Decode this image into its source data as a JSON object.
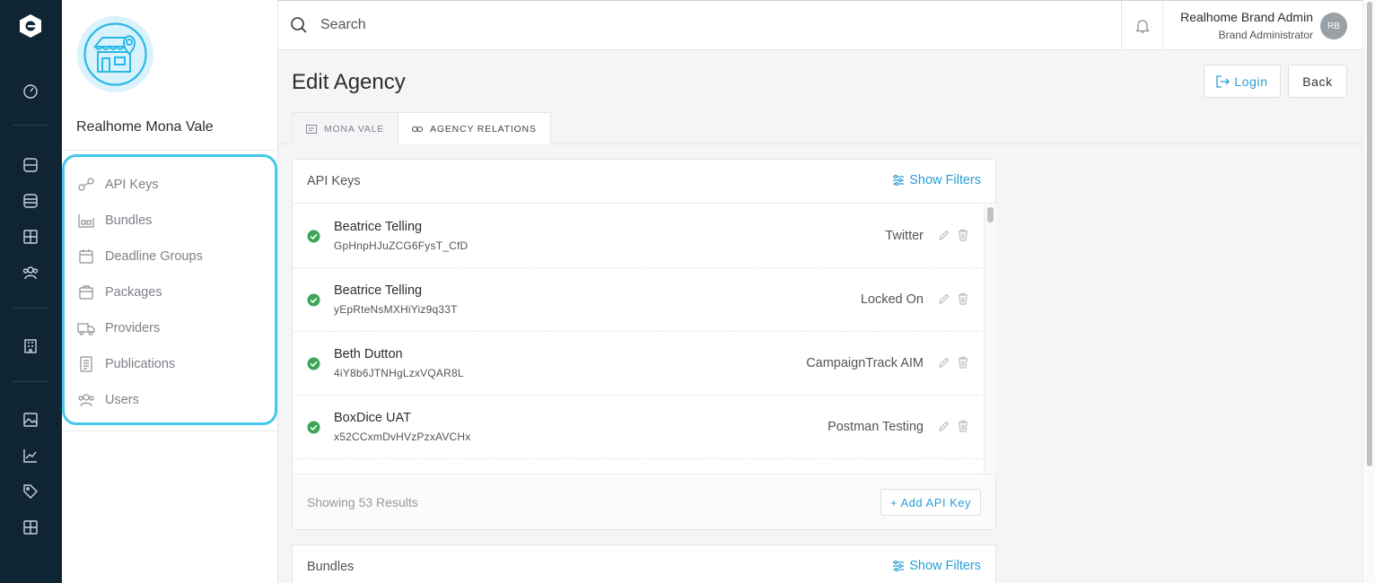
{
  "rail": {
    "icons": [
      "app-logo",
      "gauge-icon",
      "database-icon",
      "server-icon",
      "grid-icon",
      "users-icon",
      "building-icon",
      "image-icon",
      "chart-icon",
      "tag-icon",
      "table-icon"
    ]
  },
  "agency": {
    "name": "Realhome Mona Vale",
    "menu": [
      {
        "label": "API Keys",
        "icon": "api-keys-icon"
      },
      {
        "label": "Bundles",
        "icon": "bundles-icon"
      },
      {
        "label": "Deadline Groups",
        "icon": "calendar-icon"
      },
      {
        "label": "Packages",
        "icon": "package-icon"
      },
      {
        "label": "Providers",
        "icon": "truck-icon"
      },
      {
        "label": "Publications",
        "icon": "document-icon"
      },
      {
        "label": "Users",
        "icon": "users-icon"
      }
    ]
  },
  "topbar": {
    "search_placeholder": "Search",
    "user_name": "Realhome Brand Admin",
    "user_role": "Brand Administrator",
    "user_initials": "RB"
  },
  "page": {
    "title": "Edit Agency",
    "login_label": "Login",
    "back_label": "Back",
    "tabs": [
      {
        "label": "MONA VALE",
        "active": false
      },
      {
        "label": "AGENCY RELATIONS",
        "active": true
      }
    ]
  },
  "api_keys": {
    "title": "API Keys",
    "show_filters": "Show Filters",
    "rows": [
      {
        "name": "Beatrice Telling",
        "key": "GpHnpHJuZCG6FysT_CfD",
        "provider": "Twitter"
      },
      {
        "name": "Beatrice Telling",
        "key": "yEpRteNsMXHiYiz9q33T",
        "provider": "Locked On"
      },
      {
        "name": "Beth Dutton",
        "key": "4iY8b6JTNHgLzxVQAR8L",
        "provider": "CampaignTrack AIM"
      },
      {
        "name": "BoxDice UAT",
        "key": "x52CCxmDvHVzPzxAVCHx",
        "provider": "Postman Testing"
      }
    ],
    "results": "Showing 53 Results",
    "add_label": "+ Add API Key"
  },
  "bundles": {
    "title": "Bundles",
    "show_filters": "Show Filters"
  },
  "colors": {
    "rail": "#0f2533",
    "accent": "#2a9fd6",
    "highlight": "#45c8ea",
    "success": "#3aa757"
  }
}
